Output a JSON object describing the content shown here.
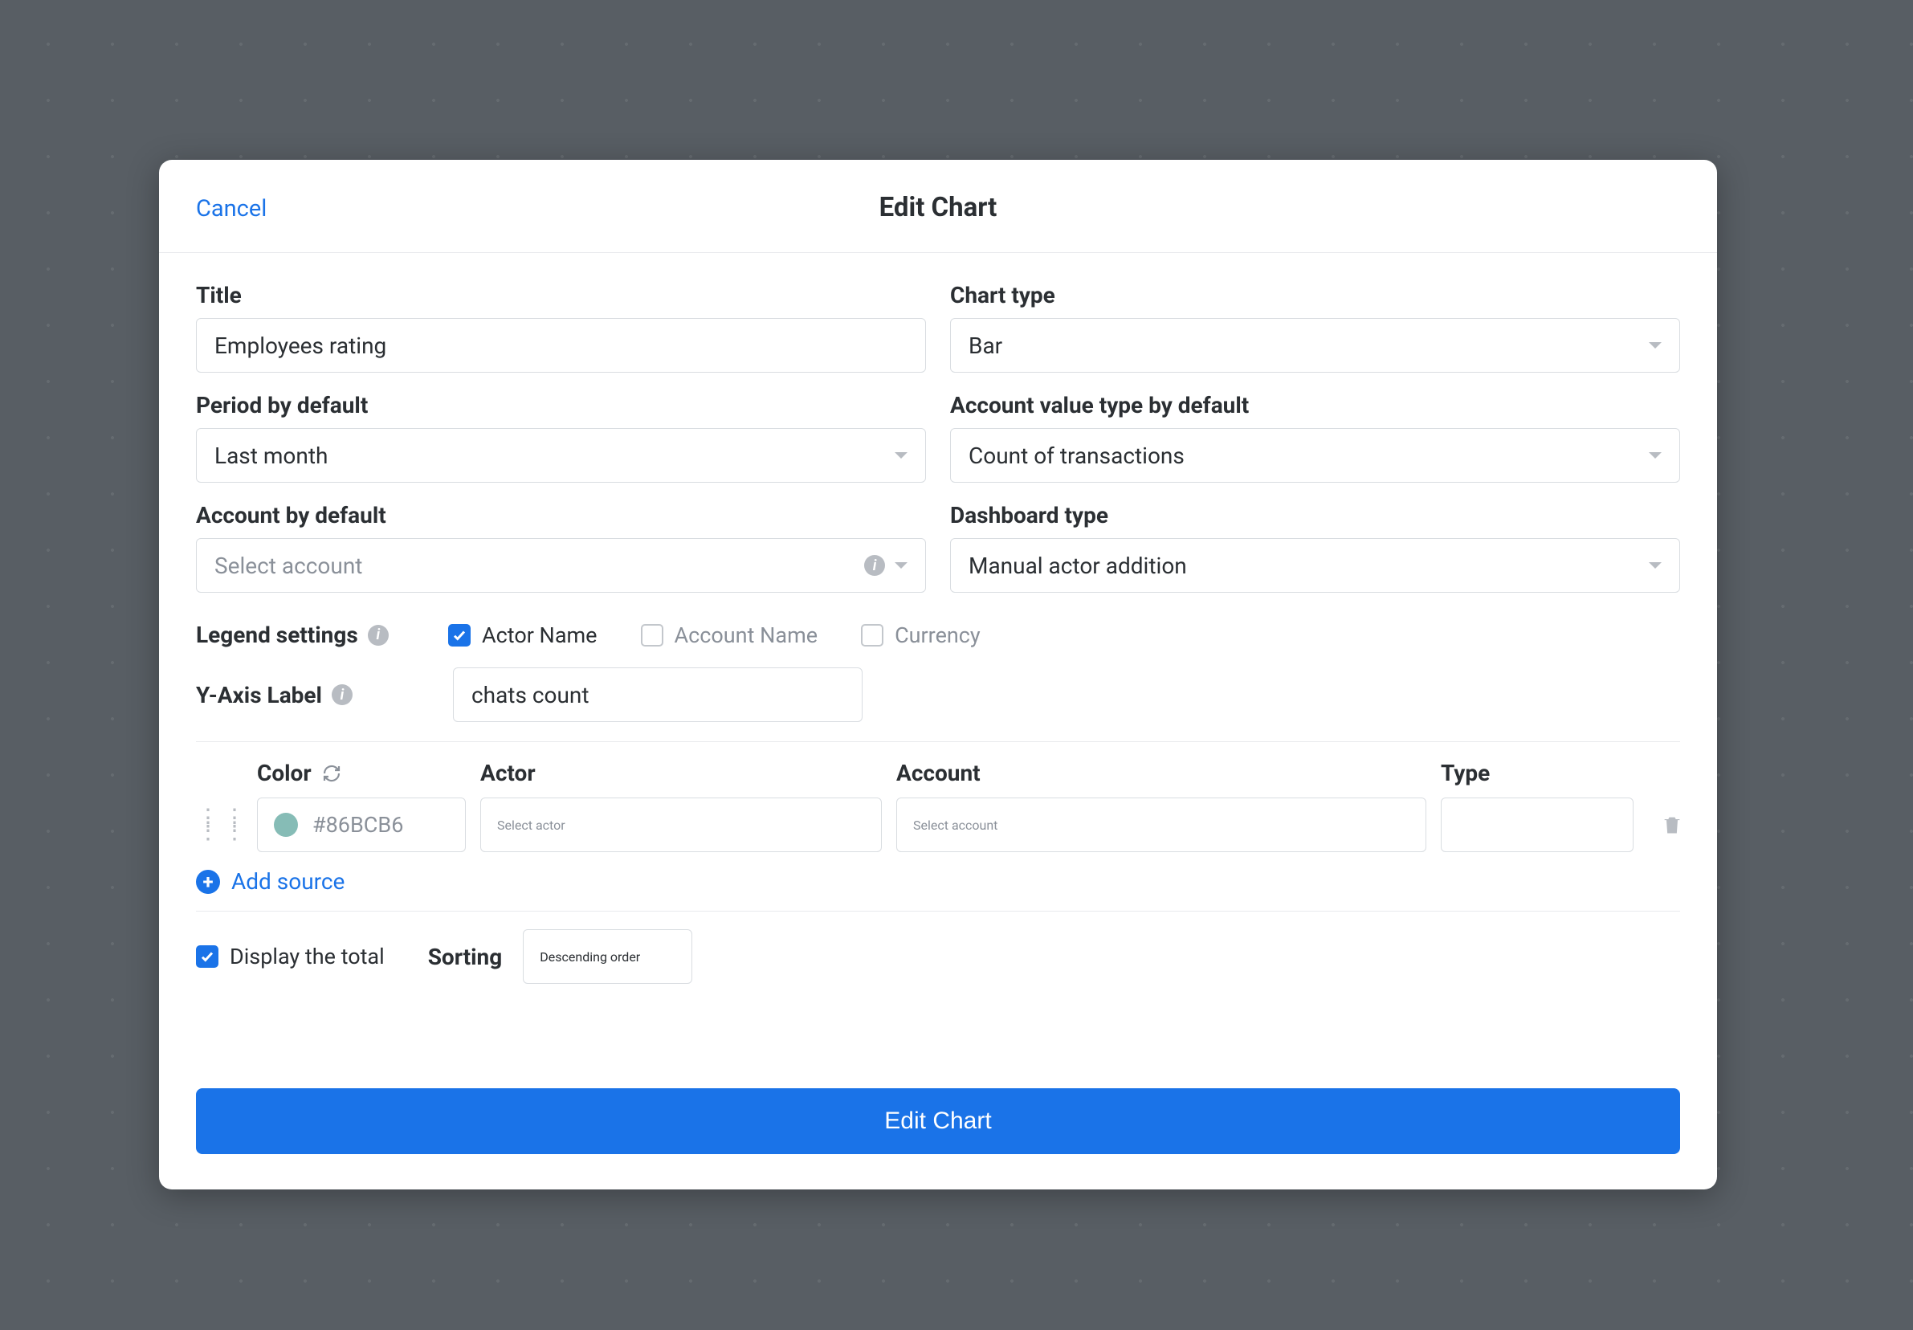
{
  "header": {
    "cancel": "Cancel",
    "title": "Edit Chart"
  },
  "fields": {
    "title_label": "Title",
    "title_value": "Employees rating",
    "chart_type_label": "Chart type",
    "chart_type_value": "Bar",
    "period_label": "Period by default",
    "period_value": "Last month",
    "account_value_type_label": "Account value type by default",
    "account_value_type_value": "Count of transactions",
    "account_default_label": "Account by default",
    "account_default_placeholder": "Select account",
    "dashboard_type_label": "Dashboard type",
    "dashboard_type_value": "Manual actor addition"
  },
  "legend": {
    "label": "Legend settings",
    "actor_name": "Actor Name",
    "account_name": "Account Name",
    "currency": "Currency"
  },
  "yaxis": {
    "label": "Y-Axis Label",
    "value": "chats count"
  },
  "sources": {
    "color_header": "Color",
    "actor_header": "Actor",
    "account_header": "Account",
    "type_header": "Type",
    "row": {
      "color_hex": "#86BCB6",
      "actor_placeholder": "Select actor",
      "account_placeholder": "Select account"
    },
    "add_source": "Add source"
  },
  "bottom": {
    "display_total": "Display the total",
    "sorting_label": "Sorting",
    "sorting_value": "Descending order"
  },
  "footer": {
    "submit": "Edit Chart"
  }
}
